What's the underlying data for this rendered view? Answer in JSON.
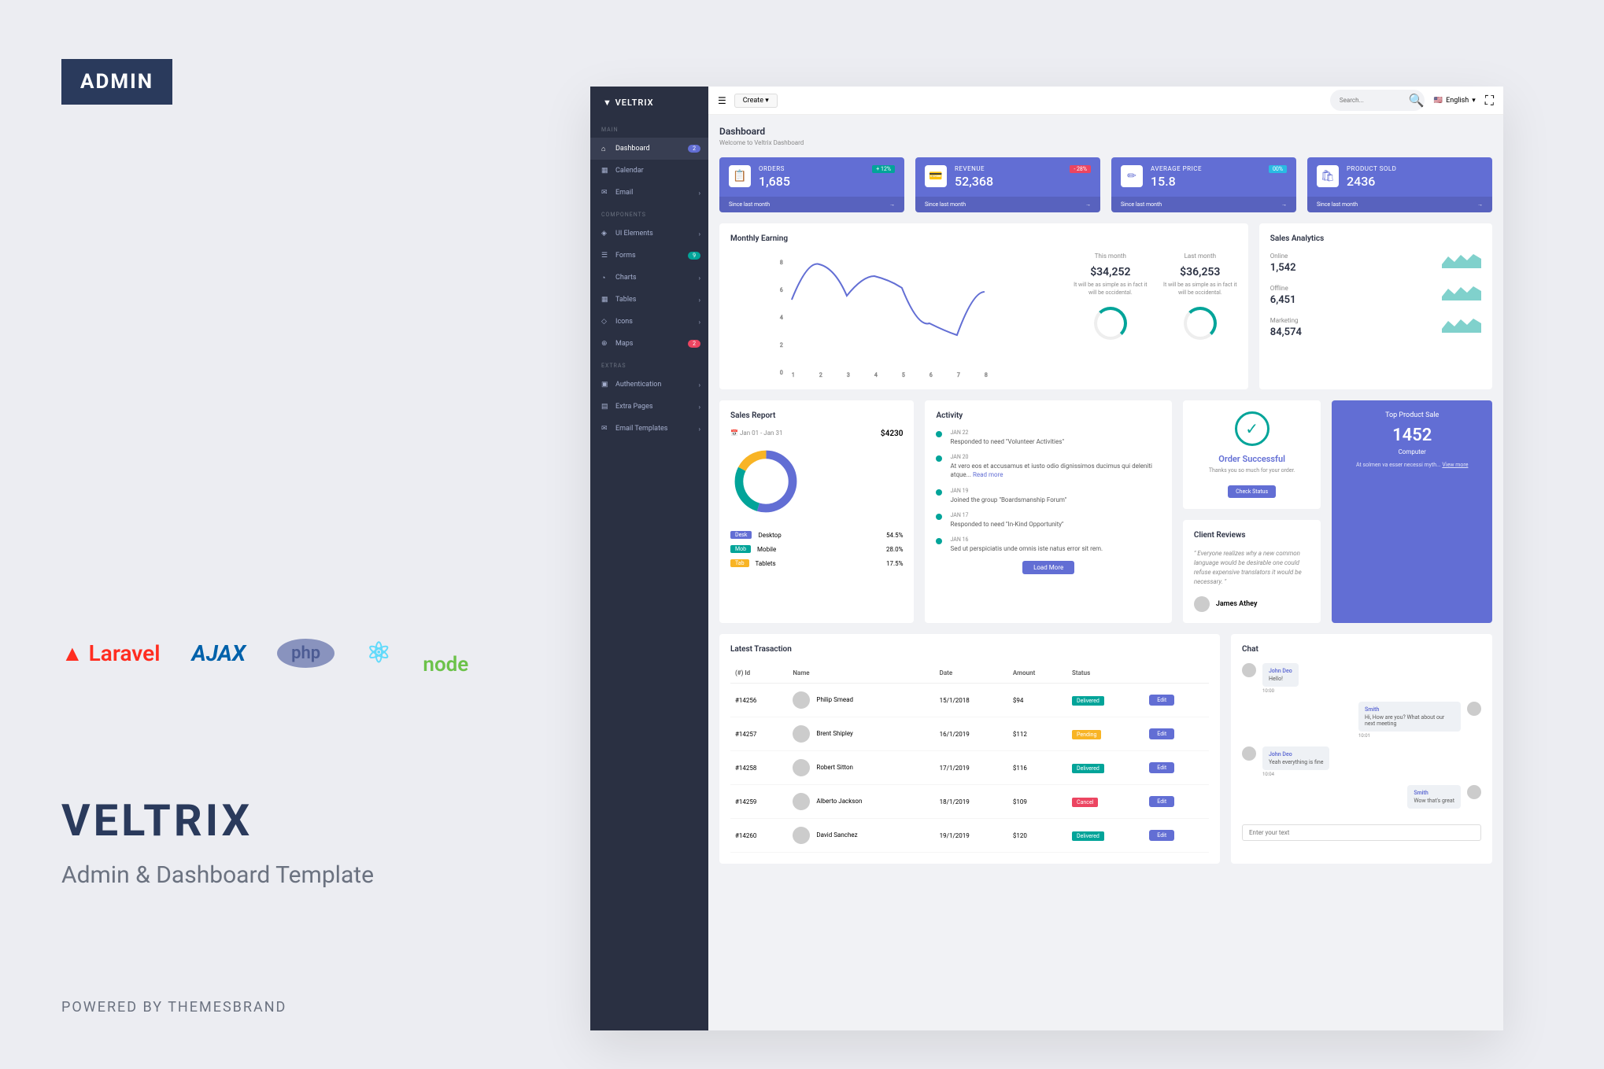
{
  "badge": "ADMIN",
  "brand": {
    "title": "VELTRIX",
    "subtitle": "Admin & Dashboard Template"
  },
  "powered": "POWERED BY THEMESBRAND",
  "tech": {
    "laravel": "Laravel",
    "ajax": "AJAX",
    "php": "php",
    "react": "⚛",
    "node": "node"
  },
  "sidebar": {
    "logo": "▼ VELTRIX",
    "sections": [
      {
        "label": "MAIN",
        "items": [
          {
            "icon": "⌂",
            "label": "Dashboard",
            "badge": "2",
            "badgeClass": "",
            "active": true
          },
          {
            "icon": "▦",
            "label": "Calendar"
          },
          {
            "icon": "✉",
            "label": "Email",
            "chevron": true
          }
        ]
      },
      {
        "label": "COMPONENTS",
        "items": [
          {
            "icon": "◈",
            "label": "UI Elements",
            "chevron": true
          },
          {
            "icon": "☰",
            "label": "Forms",
            "badge": "9",
            "badgeClass": "green"
          },
          {
            "icon": "◔",
            "label": "Charts",
            "chevron": true
          },
          {
            "icon": "▦",
            "label": "Tables",
            "chevron": true
          },
          {
            "icon": "◇",
            "label": "Icons",
            "chevron": true
          },
          {
            "icon": "⊕",
            "label": "Maps",
            "badge": "2",
            "badgeClass": "red"
          }
        ]
      },
      {
        "label": "EXTRAS",
        "items": [
          {
            "icon": "▣",
            "label": "Authentication",
            "chevron": true
          },
          {
            "icon": "▤",
            "label": "Extra Pages",
            "chevron": true
          },
          {
            "icon": "✉",
            "label": "Email Templates",
            "chevron": true
          }
        ]
      }
    ]
  },
  "topbar": {
    "create": "Create",
    "search_placeholder": "Search...",
    "lang": "English"
  },
  "header": {
    "title": "Dashboard",
    "subtitle": "Welcome to Veltrix Dashboard"
  },
  "stats": [
    {
      "icon": "📋",
      "label": "ORDERS",
      "value": "1,685",
      "badge": "+ 12%",
      "badgeClass": "green",
      "footer": "Since last month"
    },
    {
      "icon": "💳",
      "label": "REVENUE",
      "value": "52,368",
      "badge": "- 28%",
      "badgeClass": "red",
      "footer": "Since last month"
    },
    {
      "icon": "✏",
      "label": "AVERAGE PRICE",
      "value": "15.8",
      "badge": "00%",
      "badgeClass": "blue",
      "footer": "Since last month"
    },
    {
      "icon": "🛍",
      "label": "PRODUCT SOLD",
      "value": "2436",
      "footer": "Since last month"
    }
  ],
  "earning": {
    "title": "Monthly Earning",
    "cols": [
      {
        "label": "This month",
        "value": "$34,252",
        "desc": "It will be as simple as in fact it will be occidental."
      },
      {
        "label": "Last month",
        "value": "$36,253",
        "desc": "It will be as simple as in fact it will be occidental."
      }
    ]
  },
  "chart_data": {
    "type": "line",
    "title": "Monthly Earning",
    "x": [
      1,
      2,
      3,
      4,
      5,
      6,
      7,
      8
    ],
    "values": [
      5,
      8,
      5.5,
      7,
      6.3,
      4,
      3.5,
      6
    ],
    "ylim": [
      0,
      8
    ],
    "xlabel": "",
    "ylabel": ""
  },
  "analytics": {
    "title": "Sales Analytics",
    "rows": [
      {
        "label": "Online",
        "value": "1,542"
      },
      {
        "label": "Offline",
        "value": "6,451"
      },
      {
        "label": "Marketing",
        "value": "84,574"
      }
    ]
  },
  "salesReport": {
    "title": "Sales Report",
    "date": "Jan 01 - Jan 31",
    "total": "$4230",
    "items": [
      {
        "badge": "Desk",
        "badgeClass": "blue",
        "label": "Desktop",
        "pct": "54.5%"
      },
      {
        "badge": "Mob",
        "badgeClass": "green",
        "label": "Mobile",
        "pct": "28.0%"
      },
      {
        "badge": "Tab",
        "badgeClass": "orange",
        "label": "Tablets",
        "pct": "17.5%"
      }
    ]
  },
  "activity": {
    "title": "Activity",
    "items": [
      {
        "date": "JAN 22",
        "text": "Responded to need \"Volunteer Activities\""
      },
      {
        "date": "JAN 20",
        "text": "At vero eos et accusamus et iusto odio dignissimos ducimus qui deleniti atque...",
        "link": "Read more"
      },
      {
        "date": "JAN 19",
        "text": "Joined the group \"Boardsmanship Forum\""
      },
      {
        "date": "JAN 17",
        "text": "Responded to need \"In-Kind Opportunity\""
      },
      {
        "date": "JAN 16",
        "text": "Sed ut perspiciatis unde omnis iste natus error sit rem."
      }
    ],
    "button": "Load More"
  },
  "order": {
    "title": "Order Successful",
    "desc": "Thanks you so much for your order.",
    "button": "Check Status"
  },
  "topProduct": {
    "title": "Top Product Sale",
    "value": "1452",
    "name": "Computer",
    "desc": "At solmen va esser necessi myth...",
    "link": "View more"
  },
  "reviews": {
    "title": "Client Reviews",
    "text": "\" Everyone realizes why a new common language would be desirable one could refuse expensive translators it would be necessary. \"",
    "name": "James Athey"
  },
  "transactions": {
    "title": "Latest Trasaction",
    "headers": [
      "(#) Id",
      "Name",
      "Date",
      "Amount",
      "Status",
      ""
    ],
    "rows": [
      {
        "id": "#14256",
        "name": "Philip Smead",
        "date": "15/1/2018",
        "amount": "$94",
        "status": "Delivered",
        "statusClass": "delivered",
        "action": "Edit"
      },
      {
        "id": "#14257",
        "name": "Brent Shipley",
        "date": "16/1/2019",
        "amount": "$112",
        "status": "Pending",
        "statusClass": "pending",
        "action": "Edit"
      },
      {
        "id": "#14258",
        "name": "Robert Sitton",
        "date": "17/1/2019",
        "amount": "$116",
        "status": "Delivered",
        "statusClass": "delivered",
        "action": "Edit"
      },
      {
        "id": "#14259",
        "name": "Alberto Jackson",
        "date": "18/1/2019",
        "amount": "$109",
        "status": "Cancel",
        "statusClass": "cancel",
        "action": "Edit"
      },
      {
        "id": "#14260",
        "name": "David Sanchez",
        "date": "19/1/2019",
        "amount": "$120",
        "status": "Delivered",
        "statusClass": "delivered",
        "action": "Edit"
      }
    ]
  },
  "chat": {
    "title": "Chat",
    "messages": [
      {
        "side": "left",
        "name": "John Deo",
        "text": "Hello!",
        "time": "10:00"
      },
      {
        "side": "right",
        "name": "Smith",
        "text": "Hi, How are you? What about our next meeting",
        "time": "10:01"
      },
      {
        "side": "left",
        "name": "John Deo",
        "text": "Yeah everything is fine",
        "time": "10:04"
      },
      {
        "side": "right",
        "name": "Smith",
        "text": "Wow that's great",
        "time": ""
      }
    ],
    "placeholder": "Enter your text"
  }
}
